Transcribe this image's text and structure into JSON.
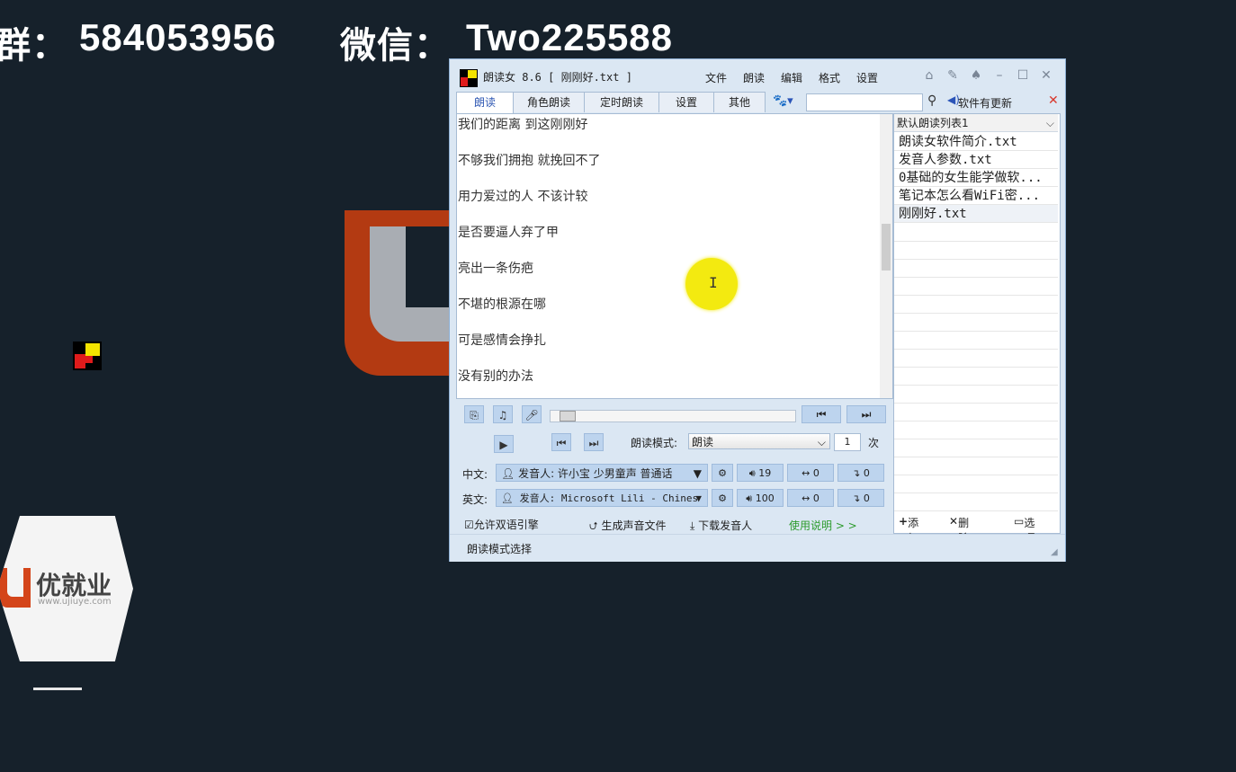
{
  "banner": {
    "qq_label": "群：",
    "qq_number": "584053956",
    "wechat_label": "微信：",
    "wechat_id": "Two225588"
  },
  "logo": {
    "brand": "优就业",
    "url": "www.ujiuye.com"
  },
  "app": {
    "title": "朗读女 8.6  [ 刚刚好.txt ]",
    "menu": [
      "文件",
      "朗读",
      "编辑",
      "格式",
      "设置"
    ],
    "tabs": [
      "朗读",
      "角色朗读",
      "定时朗读",
      "设置",
      "其他"
    ],
    "search_placeholder": "",
    "update_label": "软件有更新",
    "text_lines": [
      "我们的距离 到这刚刚好",
      "不够我们拥抱 就挽回不了",
      "用力爱过的人 不该计较",
      "是否要逼人弃了甲",
      "亮出一条伤疤",
      "不堪的根源在哪",
      "可是感情会挣扎",
      "没有别的办法"
    ],
    "playlist": {
      "selected_list": "默认朗读列表1",
      "items": [
        "朗读女软件简介.txt",
        "发音人参数.txt",
        "0基础的女生能学做软...",
        "笔记本怎么看WiFi密...",
        "刚刚好.txt"
      ],
      "add_label": "添加",
      "delete_label": "删除",
      "options_label": "选项"
    },
    "controls": {
      "mode_label": "朗读模式:",
      "mode_value": "朗读",
      "repeat_count": "1",
      "repeat_unit": "次",
      "zh_label": "中文:",
      "zh_voice": "发音人: 许小宝 少男童声 普通话",
      "zh_volume": "19",
      "zh_speed": "0",
      "zh_pitch": "0",
      "en_label": "英文:",
      "en_voice": "发音人: Microsoft Lili - Chines",
      "en_volume": "100",
      "en_speed": "0",
      "en_pitch": "0",
      "bilingual_label": "允许双语引擎",
      "generate_label": "生成声音文件",
      "download_label": "下载发音人",
      "help_label": "使用说明 > >"
    },
    "status": "朗读模式选择"
  }
}
